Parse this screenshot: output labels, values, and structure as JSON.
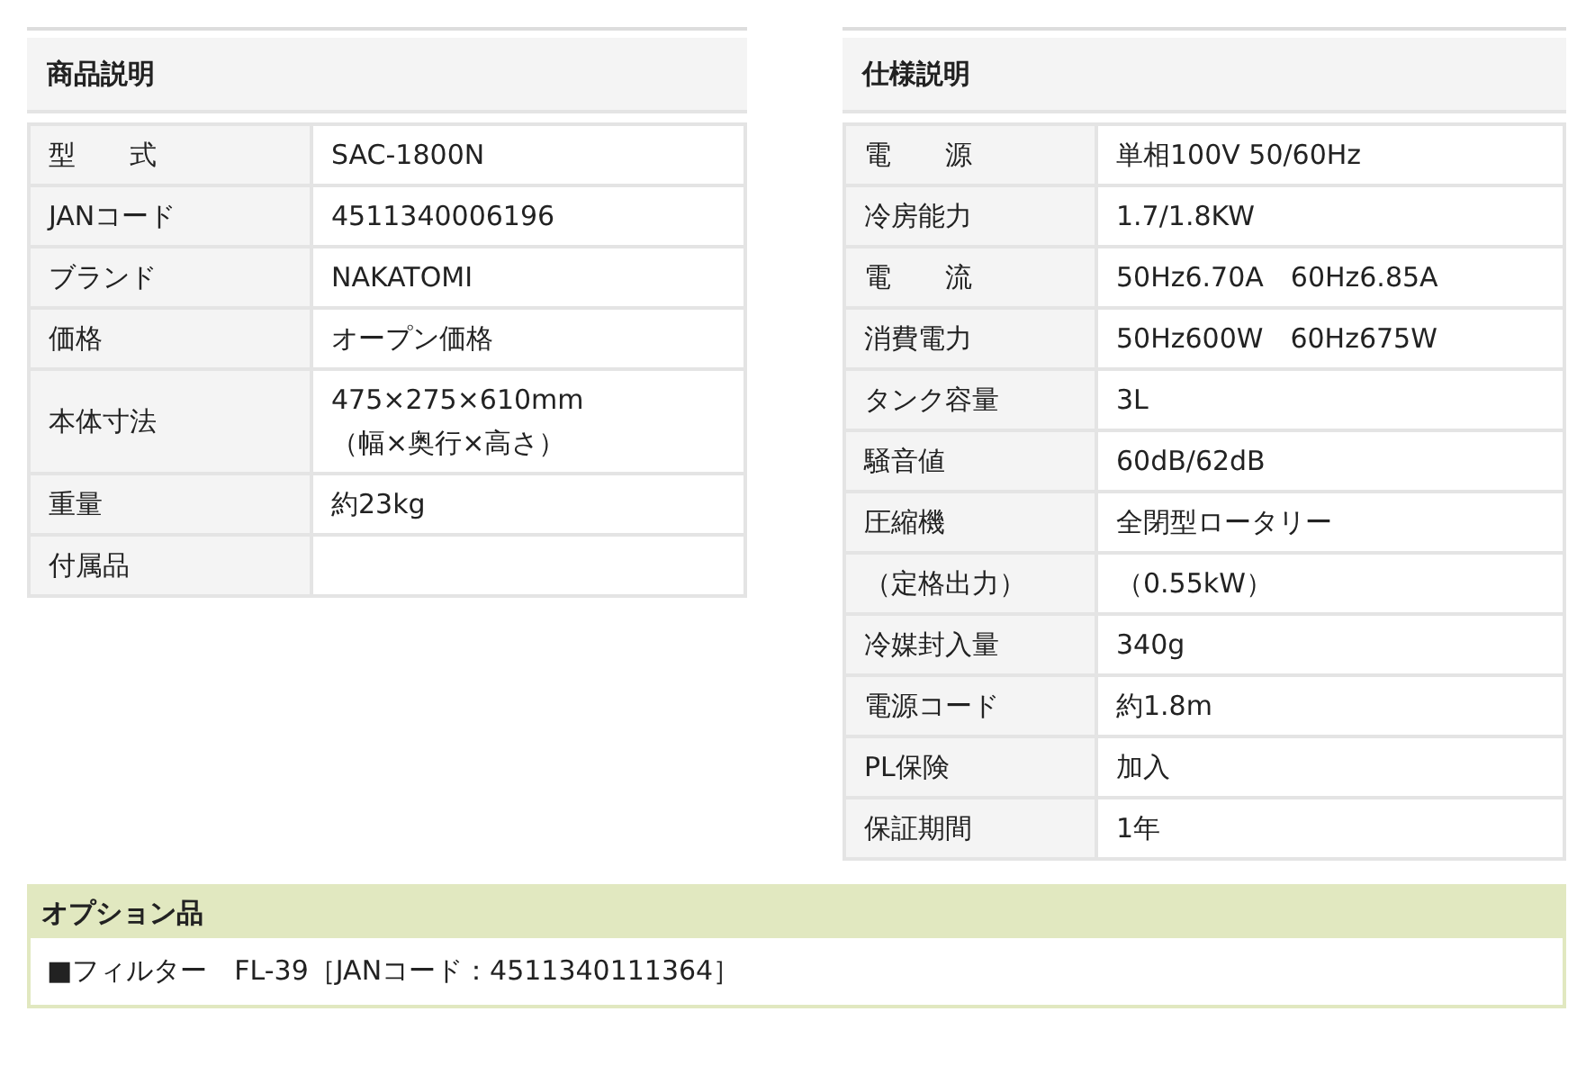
{
  "product": {
    "title": "商品説明",
    "rows": [
      {
        "label": "型　　式",
        "value": "SAC-1800N"
      },
      {
        "label": "JANコード",
        "value": "4511340006196"
      },
      {
        "label": "ブランド",
        "value": "NAKATOMI"
      },
      {
        "label": "価格",
        "value": "オープン価格"
      },
      {
        "label": "本体寸法",
        "value": "475×275×610mm\n（幅×奥行×高さ）"
      },
      {
        "label": "重量",
        "value": "約23kg"
      },
      {
        "label": "付属品"
      }
    ]
  },
  "spec": {
    "title": "仕様説明",
    "rows": [
      {
        "label": "電　　源",
        "value": "単相100V 50/60Hz"
      },
      {
        "label": "冷房能力",
        "value": "1.7/1.8KW"
      },
      {
        "label": "電　　流",
        "value": "50Hz6.70A　60Hz6.85A"
      },
      {
        "label": "消費電力",
        "value": "50Hz600W　60Hz675W"
      },
      {
        "label": "タンク容量",
        "value": "3L"
      },
      {
        "label": "騒音値",
        "value": "60dB/62dB"
      },
      {
        "label": "圧縮機",
        "value": "全閉型ロータリー"
      },
      {
        "label": "（定格出力）",
        "value": "（0.55kW）"
      },
      {
        "label": "冷媒封入量",
        "value": "340g"
      },
      {
        "label": "電源コード",
        "value": "約1.8m"
      },
      {
        "label": "PL保険",
        "value": "加入"
      },
      {
        "label": "保証期間",
        "value": "1年"
      }
    ]
  },
  "options": {
    "title": "オプション品",
    "items": [
      "■フィルター　FL-39［JANコード：4511340111364］"
    ]
  }
}
